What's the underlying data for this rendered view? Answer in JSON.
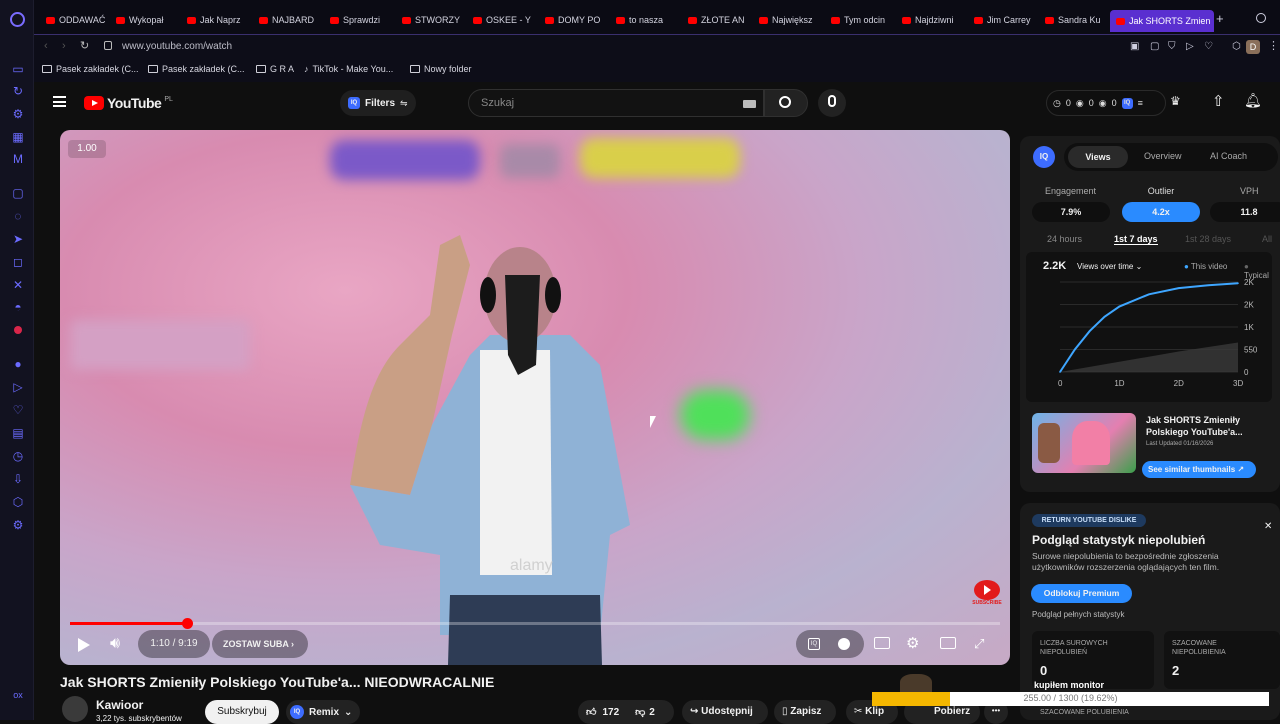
{
  "browser": {
    "tabs": [
      {
        "label": "ODDAWAĆ"
      },
      {
        "label": "Wykopał"
      },
      {
        "label": "Jak Naprz"
      },
      {
        "label": "NAJBARD"
      },
      {
        "label": "Sprawdzi"
      },
      {
        "label": "STWORZY"
      },
      {
        "label": "OSKEE - Y"
      },
      {
        "label": "DOMY PO"
      },
      {
        "label": "to nasza"
      },
      {
        "label": "ZŁOTE AN"
      },
      {
        "label": "Największ"
      },
      {
        "label": "Tym odcin"
      },
      {
        "label": "Najdziwni"
      },
      {
        "label": "Jim Carrey"
      },
      {
        "label": "Sandra Ku"
      },
      {
        "label": "Jak SHORTS Zmien",
        "active": true
      }
    ],
    "new_tab": "+",
    "url": "www.youtube.com/watch",
    "bookmarks": [
      "Pasek zakładek (C...",
      "Pasek zakładek (C...",
      "G R A",
      "TikTok - Make You...",
      "Nowy folder"
    ],
    "profile_initial": "D"
  },
  "youtube": {
    "logo": "YouTube",
    "logo_region": "PL",
    "filters_label": "Filters",
    "iq_badge": "IQ",
    "search_placeholder": "Szukaj",
    "header_counters": [
      "0",
      "0",
      "0"
    ]
  },
  "player": {
    "speed_badge": "1.00",
    "time": "1:10 / 9:19",
    "chapter": "ZOSTAW SUBA",
    "progress_fraction": 0.126,
    "subscribe_watermark": "SUBSCRIBE",
    "overlay_text": "alamy"
  },
  "video_info": {
    "title": "Jak SHORTS Zmieniły Polskiego YouTube'a... NIEODWRACALNIE",
    "channel": "Kawioor",
    "subs": "3,22 tys. subskrybentów",
    "subscribe": "Subskrybuj",
    "remix": "Remix",
    "likes": "172",
    "dislikes": "2",
    "share": "Udostępnij",
    "save": "Zapisz",
    "clip": "Klip",
    "download": "Pobierz",
    "more": "•••"
  },
  "vidiq": {
    "logo": "IQ",
    "tabs": [
      "Views",
      "Overview",
      "AI Coach"
    ],
    "metrics": [
      {
        "label": "Engagement",
        "value": "7.9%"
      },
      {
        "label": "Outlier",
        "value": "4.2x"
      },
      {
        "label": "VPH",
        "value": "11.8"
      }
    ],
    "ranges": [
      "24 hours",
      "1st 7 days",
      "1st 28 days",
      "All"
    ],
    "total_views": "2.2K",
    "dropdown": "Views over time",
    "legend_this": "This video",
    "legend_typical": "Typical",
    "thumb_title": "Jak SHORTS Zmieniły Polskiego YouTube'a...",
    "thumb_updated": "Last Updated 01/16/2026",
    "similar_btn": "See similar thumbnails"
  },
  "chart_data": {
    "type": "area",
    "x_ticks": [
      "0",
      "1D",
      "2D",
      "3D"
    ],
    "y_ticks": [
      "0",
      "550",
      "1K",
      "2K",
      "2K"
    ],
    "series": [
      {
        "name": "This video",
        "color": "#3ea6ff",
        "x": [
          0,
          0.25,
          0.5,
          0.75,
          1.0,
          1.5,
          2.0,
          2.5,
          3.0
        ],
        "values": [
          0,
          550,
          1000,
          1350,
          1600,
          1900,
          2050,
          2120,
          2170
        ]
      },
      {
        "name": "Typical",
        "color": "#3a3a3a",
        "x": [
          0,
          1,
          2,
          3
        ],
        "values": [
          0,
          250,
          500,
          720
        ]
      }
    ],
    "ylim": [
      0,
      2200
    ],
    "xlim": [
      0,
      3
    ]
  },
  "dislike": {
    "badge": "RETURN YOUTUBE DISLIKE",
    "title": "Podgląd statystyk niepolubień",
    "desc": "Surowe niepolubienia to bezpośrednie zgłoszenia użytkowników rozszerzenia oglądających ten film.",
    "btn": "Odblokuj Premium",
    "footer": "Podgląd pełnych statystyk",
    "raw_label": "LICZBA SUROWYCH NIEPOLUBIEŃ",
    "raw_value": "0",
    "est_label": "SZACOWANE NIEPOLUBIENIA",
    "est_value": "2",
    "est_likes_label": "SZACOWANE POLUBIENIA"
  },
  "overlay": {
    "monitor_label": "kupiłem monitor",
    "progress_text": "255.00 / 1300 (19.62%)",
    "progress_fraction": 0.1962
  }
}
